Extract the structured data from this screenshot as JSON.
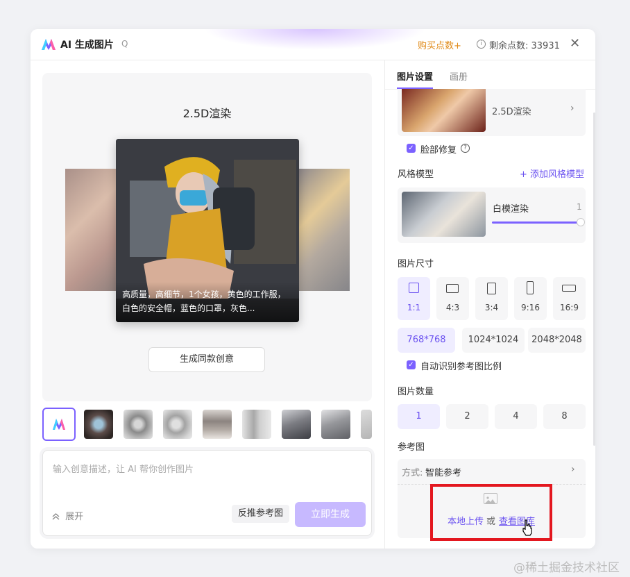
{
  "header": {
    "title": "AI 生成图片",
    "title_suffix": "Q",
    "buy_label": "购买点数+",
    "points_label": "剩余点数: 33931",
    "close_glyph": "✕"
  },
  "preview": {
    "style_title": "2.5D渲染",
    "caption": "高质量，高细节，1个女孩，黄色的工作服，白色的安全帽，蓝色的口罩，灰色...",
    "same_button": "生成同款创意"
  },
  "thumbnails": [
    {
      "name": "logo",
      "color": "#ffffff"
    },
    {
      "name": "eye",
      "color": "#6a5a55"
    },
    {
      "name": "fan-1",
      "color": "#9a9a9a"
    },
    {
      "name": "fan-2",
      "color": "#b1b1b1"
    },
    {
      "name": "vase",
      "color": "#8c8480"
    },
    {
      "name": "bottle",
      "color": "#a8a8a8"
    },
    {
      "name": "woman-bust-1",
      "color": "#7c7d83"
    },
    {
      "name": "woman-bust-2",
      "color": "#96979b"
    },
    {
      "name": "partial",
      "color": "#b5b5b5"
    }
  ],
  "input": {
    "placeholder": "输入创意描述，让 AI 帮你创作图片",
    "expand_label": "展开",
    "reverse_button": "反推参考图",
    "generate_button": "立即生成"
  },
  "tabs": [
    {
      "label": "图片设置"
    },
    {
      "label": "画册"
    }
  ],
  "style": {
    "name": "2.5D渲染",
    "face_fix_label": "脸部修复"
  },
  "style_model": {
    "section_label": "风格模型",
    "add_label": "+ 添加风格模型",
    "name": "白模渲染",
    "value": "1"
  },
  "image_size": {
    "section_label": "图片尺寸",
    "ratios": [
      {
        "label": "1:1"
      },
      {
        "label": "4:3"
      },
      {
        "label": "3:4"
      },
      {
        "label": "9:16"
      },
      {
        "label": "16:9"
      }
    ],
    "resolutions": [
      {
        "label": "768*768"
      },
      {
        "label": "1024*1024"
      },
      {
        "label": "2048*2048"
      }
    ],
    "auto_ratio_label": "自动识别参考图比例"
  },
  "quantity": {
    "section_label": "图片数量",
    "options": [
      {
        "label": "1"
      },
      {
        "label": "2"
      },
      {
        "label": "4"
      },
      {
        "label": "8"
      }
    ]
  },
  "reference": {
    "section_label": "参考图",
    "mode_label": "方式:",
    "mode_value": "智能参考",
    "upload_label": "本地上传",
    "or_label": "或",
    "gallery_label": "查看图库"
  },
  "watermark": "@稀土掘金技术社区",
  "colors": {
    "accent": "#7b61ff",
    "buy": "#e08a17",
    "highlight": "#e3171f"
  }
}
